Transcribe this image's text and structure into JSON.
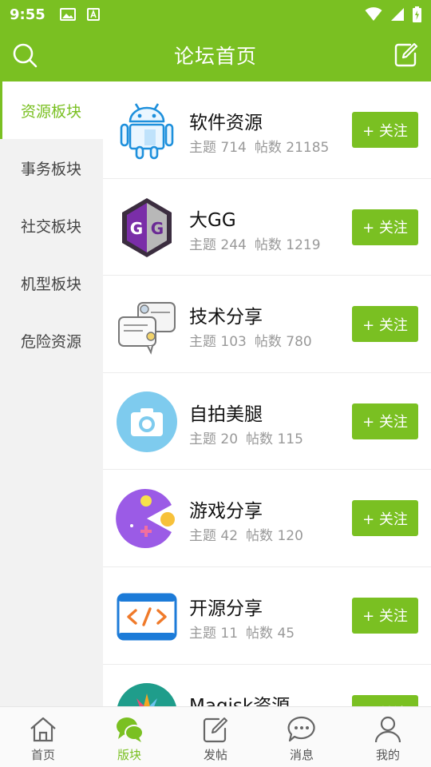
{
  "status_bar": {
    "time": "9:55"
  },
  "header": {
    "title": "论坛首页"
  },
  "sidebar": {
    "items": [
      {
        "label": "资源板块",
        "active": true
      },
      {
        "label": "事务板块",
        "active": false
      },
      {
        "label": "社交板块",
        "active": false
      },
      {
        "label": "机型板块",
        "active": false
      },
      {
        "label": "危险资源",
        "active": false
      }
    ]
  },
  "forums": [
    {
      "name": "软件资源",
      "topics": "主题 714",
      "posts": "帖数 21185",
      "follow": "+ 关注",
      "icon": "android-robot-icon"
    },
    {
      "name": "大GG",
      "topics": "主题 244",
      "posts": "帖数 1219",
      "follow": "+ 关注",
      "icon": "gameguardian-icon"
    },
    {
      "name": "技术分享",
      "topics": "主题 103",
      "posts": "帖数 780",
      "follow": "+ 关注",
      "icon": "chat-bubbles-icon"
    },
    {
      "name": "自拍美腿",
      "topics": "主题 20",
      "posts": "帖数 115",
      "follow": "+ 关注",
      "icon": "camera-icon"
    },
    {
      "name": "游戏分享",
      "topics": "主题 42",
      "posts": "帖数 120",
      "follow": "+ 关注",
      "icon": "game-pacman-icon"
    },
    {
      "name": "开源分享",
      "topics": "主题 11",
      "posts": "帖数 45",
      "follow": "+ 关注",
      "icon": "code-brackets-icon"
    },
    {
      "name": "Magisk资源",
      "topics": "",
      "posts": "",
      "follow": "+ 关注",
      "icon": "magisk-icon"
    }
  ],
  "bottom_nav": [
    {
      "label": "首页",
      "icon": "home-icon",
      "active": false
    },
    {
      "label": "版块",
      "icon": "chat-bubbles-icon",
      "active": true
    },
    {
      "label": "发帖",
      "icon": "compose-icon",
      "active": false
    },
    {
      "label": "消息",
      "icon": "message-icon",
      "active": false
    },
    {
      "label": "我的",
      "icon": "profile-icon",
      "active": false
    }
  ],
  "colors": {
    "accent": "#7ac022",
    "sidebar_bg": "#f2f2f2",
    "stats_text": "#999999"
  }
}
